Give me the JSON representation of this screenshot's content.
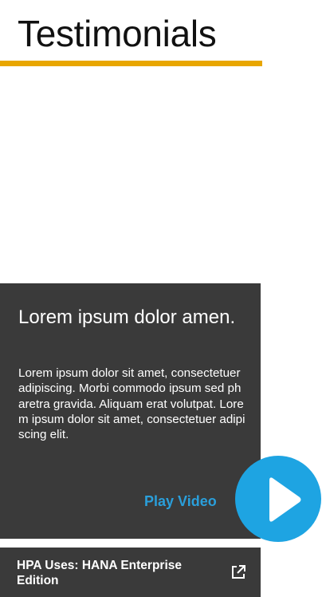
{
  "page": {
    "title": "Testimonials"
  },
  "testimonial": {
    "heading": "Lorem ipsum dolor amen.",
    "body": "Lorem ipsum dolor sit amet, consectetuer adipiscing. Morbi commodo ipsum sed pharetra gravida. Aliquam erat volutpat. Lorem ipsum dolor sit amet, consectetuer adipiscing elit.",
    "play_label": "Play Video",
    "play_icon": "play-icon"
  },
  "link": {
    "label": "HPA Uses: HANA Enterprise Edition",
    "icon": "external-link-icon"
  },
  "colors": {
    "accent": "#e8a600",
    "card_background": "#3a3a3a",
    "link_blue": "#2a9fdb",
    "play_button": "#1ea4e2"
  }
}
